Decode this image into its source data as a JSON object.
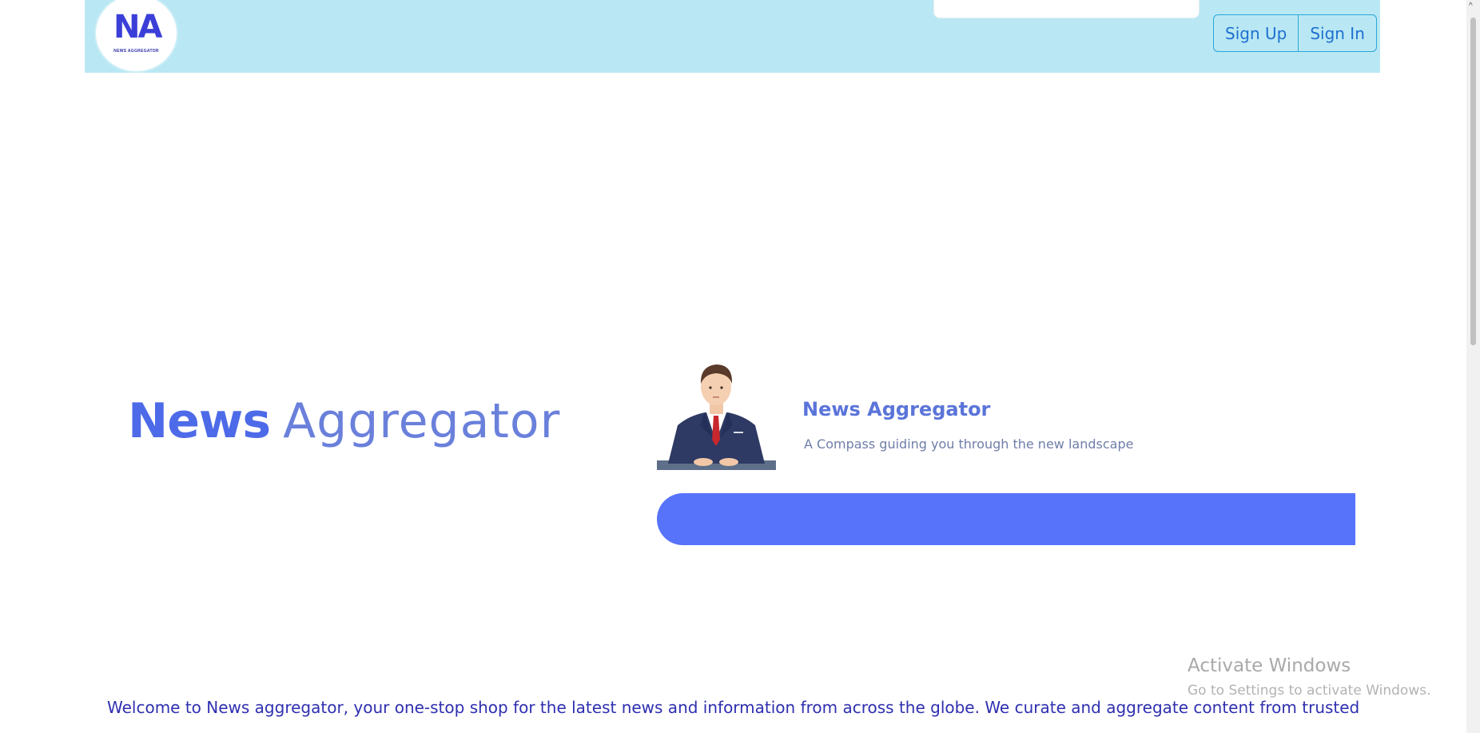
{
  "header": {
    "logo": {
      "mark": "NA",
      "subtitle": "NEWS AGGREGATOR"
    },
    "search": {
      "placeholder": ""
    },
    "auth": {
      "sign_up": "Sign Up",
      "sign_in": "Sign In"
    },
    "colors": {
      "background": "#b9e8f4",
      "button_border": "#2aa7d8",
      "button_text": "#1f6fd0"
    }
  },
  "hero": {
    "title_bold": "News",
    "title_light": "Aggregator",
    "card": {
      "title": "News Aggregator",
      "subtitle": "A Compass guiding you through the new landscape",
      "bar_color": "#5673fa"
    }
  },
  "welcome": {
    "text": "Welcome to News aggregator, your one-stop shop for the latest news and information from across the globe. We curate and aggregate content from trusted"
  },
  "watermark": {
    "title": "Activate Windows",
    "subtitle": "Go to Settings to activate Windows."
  },
  "scrollbar": {
    "up_arrow": "^"
  }
}
